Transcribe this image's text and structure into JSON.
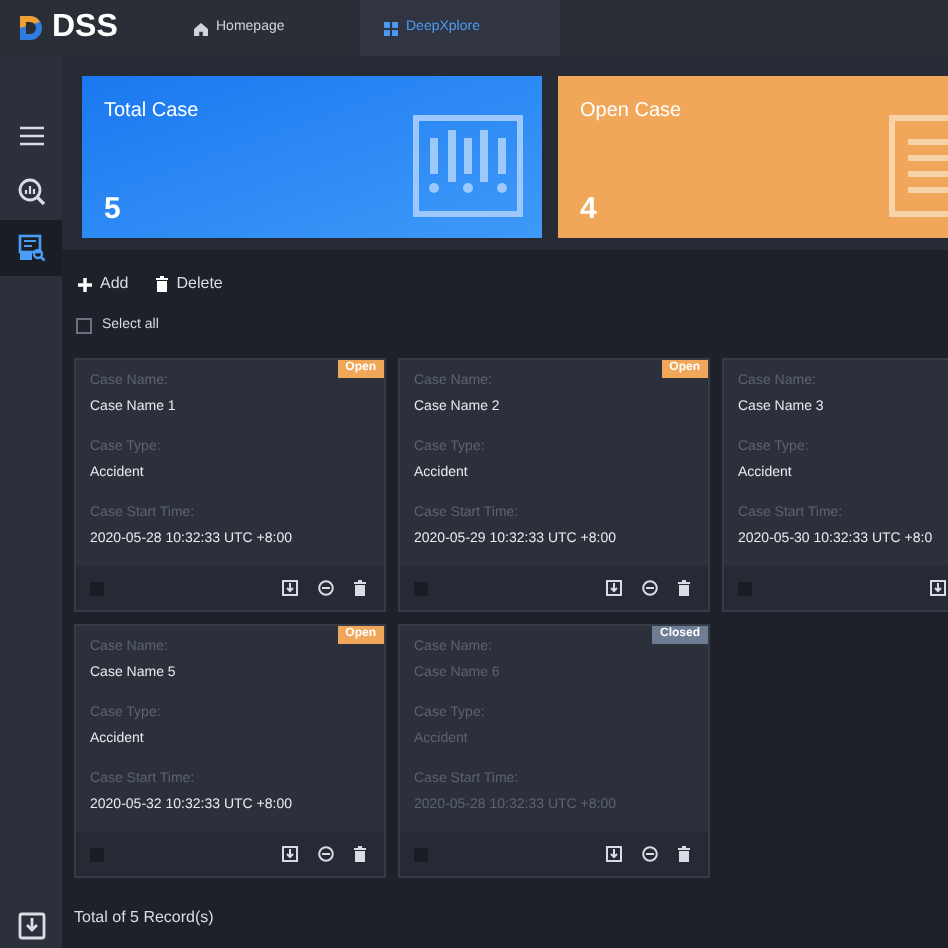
{
  "app": {
    "logo": "DSS"
  },
  "tabs": [
    {
      "label": "Homepage",
      "kind": "home",
      "selected": false
    },
    {
      "label": "DeepXplore",
      "kind": "grid",
      "selected": true
    }
  ],
  "sidebar": {
    "items": [
      {
        "kind": "menu",
        "selected": false
      },
      {
        "kind": "analytics",
        "selected": false
      },
      {
        "kind": "cases",
        "selected": true
      }
    ]
  },
  "stats": [
    {
      "title": "Total Case",
      "value": "5",
      "kind": "total"
    },
    {
      "title": "Open Case",
      "value": "4",
      "kind": "open"
    }
  ],
  "toolbar": {
    "add": "Add",
    "delete": "Delete",
    "select_all": {
      "label": "Select all",
      "checked": false
    }
  },
  "cases": [
    {
      "badge": "Open",
      "kind": "open",
      "name_label": "Case Name:",
      "name": "Case Name 1",
      "type_label": "Case Type:",
      "type": "Accident",
      "time_label": "Case Start Time:",
      "time": "2020-05-28 10:32:33 UTC +8:00",
      "checked": false
    },
    {
      "badge": "Open",
      "kind": "open",
      "name_label": "Case Name:",
      "name": "Case Name 2",
      "type_label": "Case Type:",
      "type": "Accident",
      "time_label": "Case Start Time:",
      "time": "2020-05-29 10:32:33 UTC +8:00",
      "checked": false
    },
    {
      "kind": "open",
      "name_label": "Case Name:",
      "name": "Case Name 3",
      "type_label": "Case Type:",
      "type": "Accident",
      "time_label": "Case Start Time:",
      "time": "2020-05-30 10:32:33 UTC +8:0",
      "checked": false
    },
    {
      "badge": "Open",
      "kind": "open",
      "name_label": "Case Name:",
      "name": "Case Name 5",
      "type_label": "Case Type:",
      "type": "Accident",
      "time_label": "Case Start Time:",
      "time": "2020-05-32 10:32:33 UTC +8:00",
      "checked": false
    },
    {
      "badge": "Closed",
      "kind": "closed",
      "name_label": "Case Name:",
      "name": "Case Name 6",
      "type_label": "Case Type:",
      "type": "Accident",
      "time_label": "Case Start Time:",
      "time": "2020-05-28 10:32:33 UTC +8:00",
      "checked": false
    }
  ],
  "footer": {
    "total": "Total of 5 Record(s)"
  }
}
